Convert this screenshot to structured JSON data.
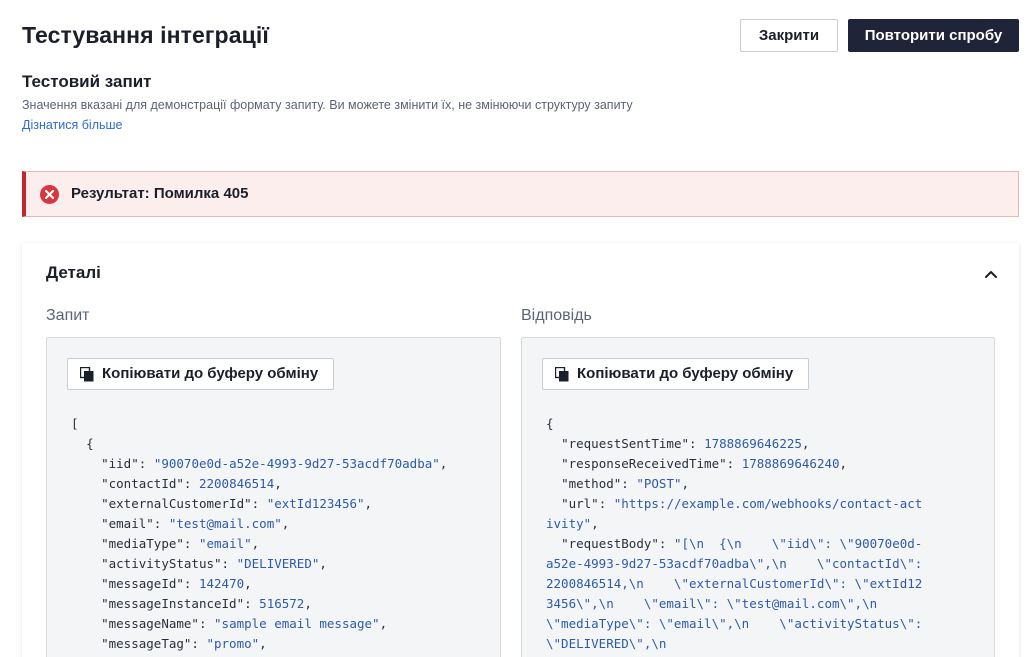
{
  "header": {
    "title": "Тестування інтеграції",
    "close_label": "Закрити",
    "retry_label": "Повторити спробу"
  },
  "test_request": {
    "title": "Тестовий запит",
    "description": "Значення вказані для демонстрації формату запиту. Ви можете змінити їх, не змінюючи структуру запиту",
    "learn_more": "Дізнатися більше"
  },
  "alert": {
    "icon": "error-circle-icon",
    "text": "Результат: Помилка 405",
    "color": "#c2272d"
  },
  "details": {
    "title": "Деталі",
    "request": {
      "label": "Запит",
      "copy_label": "Копіювати до буферу обміну",
      "lines": [
        "[",
        "  {",
        "    \"iid\": \"90070e0d-a52e-4993-9d27-53acdf70adba\",",
        "    \"contactId\": 2200846514,",
        "    \"externalCustomerId\": \"extId123456\",",
        "    \"email\": \"test@mail.com\",",
        "    \"mediaType\": \"email\",",
        "    \"activityStatus\": \"DELIVERED\",",
        "    \"messageId\": 142470,",
        "    \"messageInstanceId\": 516572,",
        "    \"messageName\": \"sample email message\",",
        "    \"messageTag\": \"promo\","
      ]
    },
    "response": {
      "label": "Відповідь",
      "copy_label": "Копіювати до буферу обміну",
      "lines": [
        "{",
        "  \"requestSentTime\": 1788869646225,",
        "  \"responseReceivedTime\": 1788869646240,",
        "  \"method\": \"POST\",",
        "  \"url\": \"https://example.com/webhooks/contact-activity\",",
        "  \"requestBody\": \"[\\n  {\\n    \\\"iid\\\": \\\"90070e0d-a52e-4993-9d27-53acdf70adba\\\",\\n    \\\"contactId\\\": 2200846514,\\n    \\\"externalCustomerId\\\": \\\"extId123456\\\",\\n    \\\"email\\\": \\\"test@mail.com\\\",\\n    \\\"mediaType\\\": \\\"email\\\",\\n    \\\"activityStatus\\\": \\\"DELIVERED\\\",\\n"
      ]
    }
  }
}
